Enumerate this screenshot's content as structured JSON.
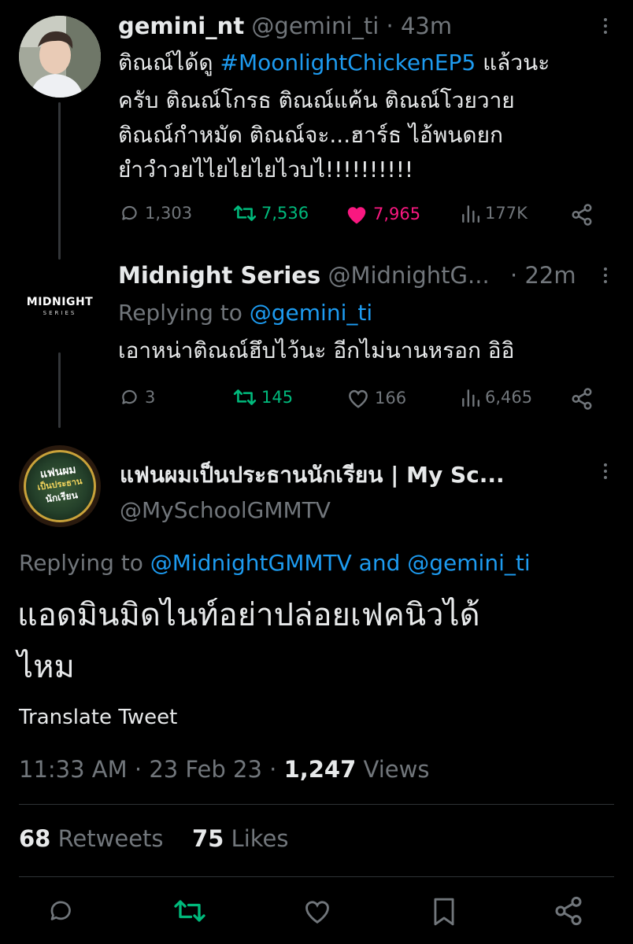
{
  "tweet1": {
    "name": "gemini_nt",
    "handle": "@gemini_ti",
    "sep": "·",
    "time": "43m",
    "text_1": "ติณณ์ได้ดู ",
    "hashtag": "#MoonlightChickenEP5",
    "text_2": " แล้วนะ",
    "line2": "ครับ ติณณ์โกรธ ติณณ์แค้น ติณณ์โวยวาย",
    "line3": "ติณณ์กำหมัด ติณณ์จะ...ฮาร์ธ ไอ้พนดยก",
    "line4": "ยำวำวยไไยไยไยไวบไ!!!!!!!!!!",
    "replies": "1,303",
    "retweets": "7,536",
    "likes": "7,965",
    "views": "177K"
  },
  "tweet2": {
    "name": "Midnight Series",
    "handle": "@MidnightG...",
    "sep": "·",
    "time": "22m",
    "replying_prefix": "Replying to ",
    "replying_to": "@gemini_ti",
    "text": "เอาหน่าติณณ์ฮึบไว้นะ อีกไม่นานหรอก อิอิ",
    "avatar_word": "MIDNIGHT",
    "avatar_sub": "SERIES",
    "replies": "3",
    "retweets": "145",
    "likes": "166",
    "views": "6,465"
  },
  "main": {
    "name": "แฟนผมเป็นประธานนักเรียน | My Sc...",
    "handle": "@MySchoolGMMTV",
    "avatar_line1": "แฟนผม",
    "avatar_line2": "เป็นประธาน",
    "avatar_line3": "นักเรียน",
    "replying_prefix": "Replying to ",
    "replying_to_1": "@MidnightGMMTV",
    "replying_and": " and ",
    "replying_to_2": "@gemini_ti",
    "text_line1": "แอดมินมิดไนท์อย่าปล่อยเฟคนิวได้",
    "text_line2": "ไหม",
    "translate": "Translate Tweet",
    "time": "11:33 AM",
    "sep": "·",
    "date": "23 Feb 23",
    "views_count": "1,247",
    "views_label": " Views",
    "retweets_count": "68",
    "retweets_label": " Retweets",
    "likes_count": "75",
    "likes_label": " Likes"
  },
  "colors": {
    "retweet_green": "#00ba7c",
    "like_pink": "#f91880",
    "link_blue": "#1d9bf0",
    "muted": "#71767b"
  }
}
